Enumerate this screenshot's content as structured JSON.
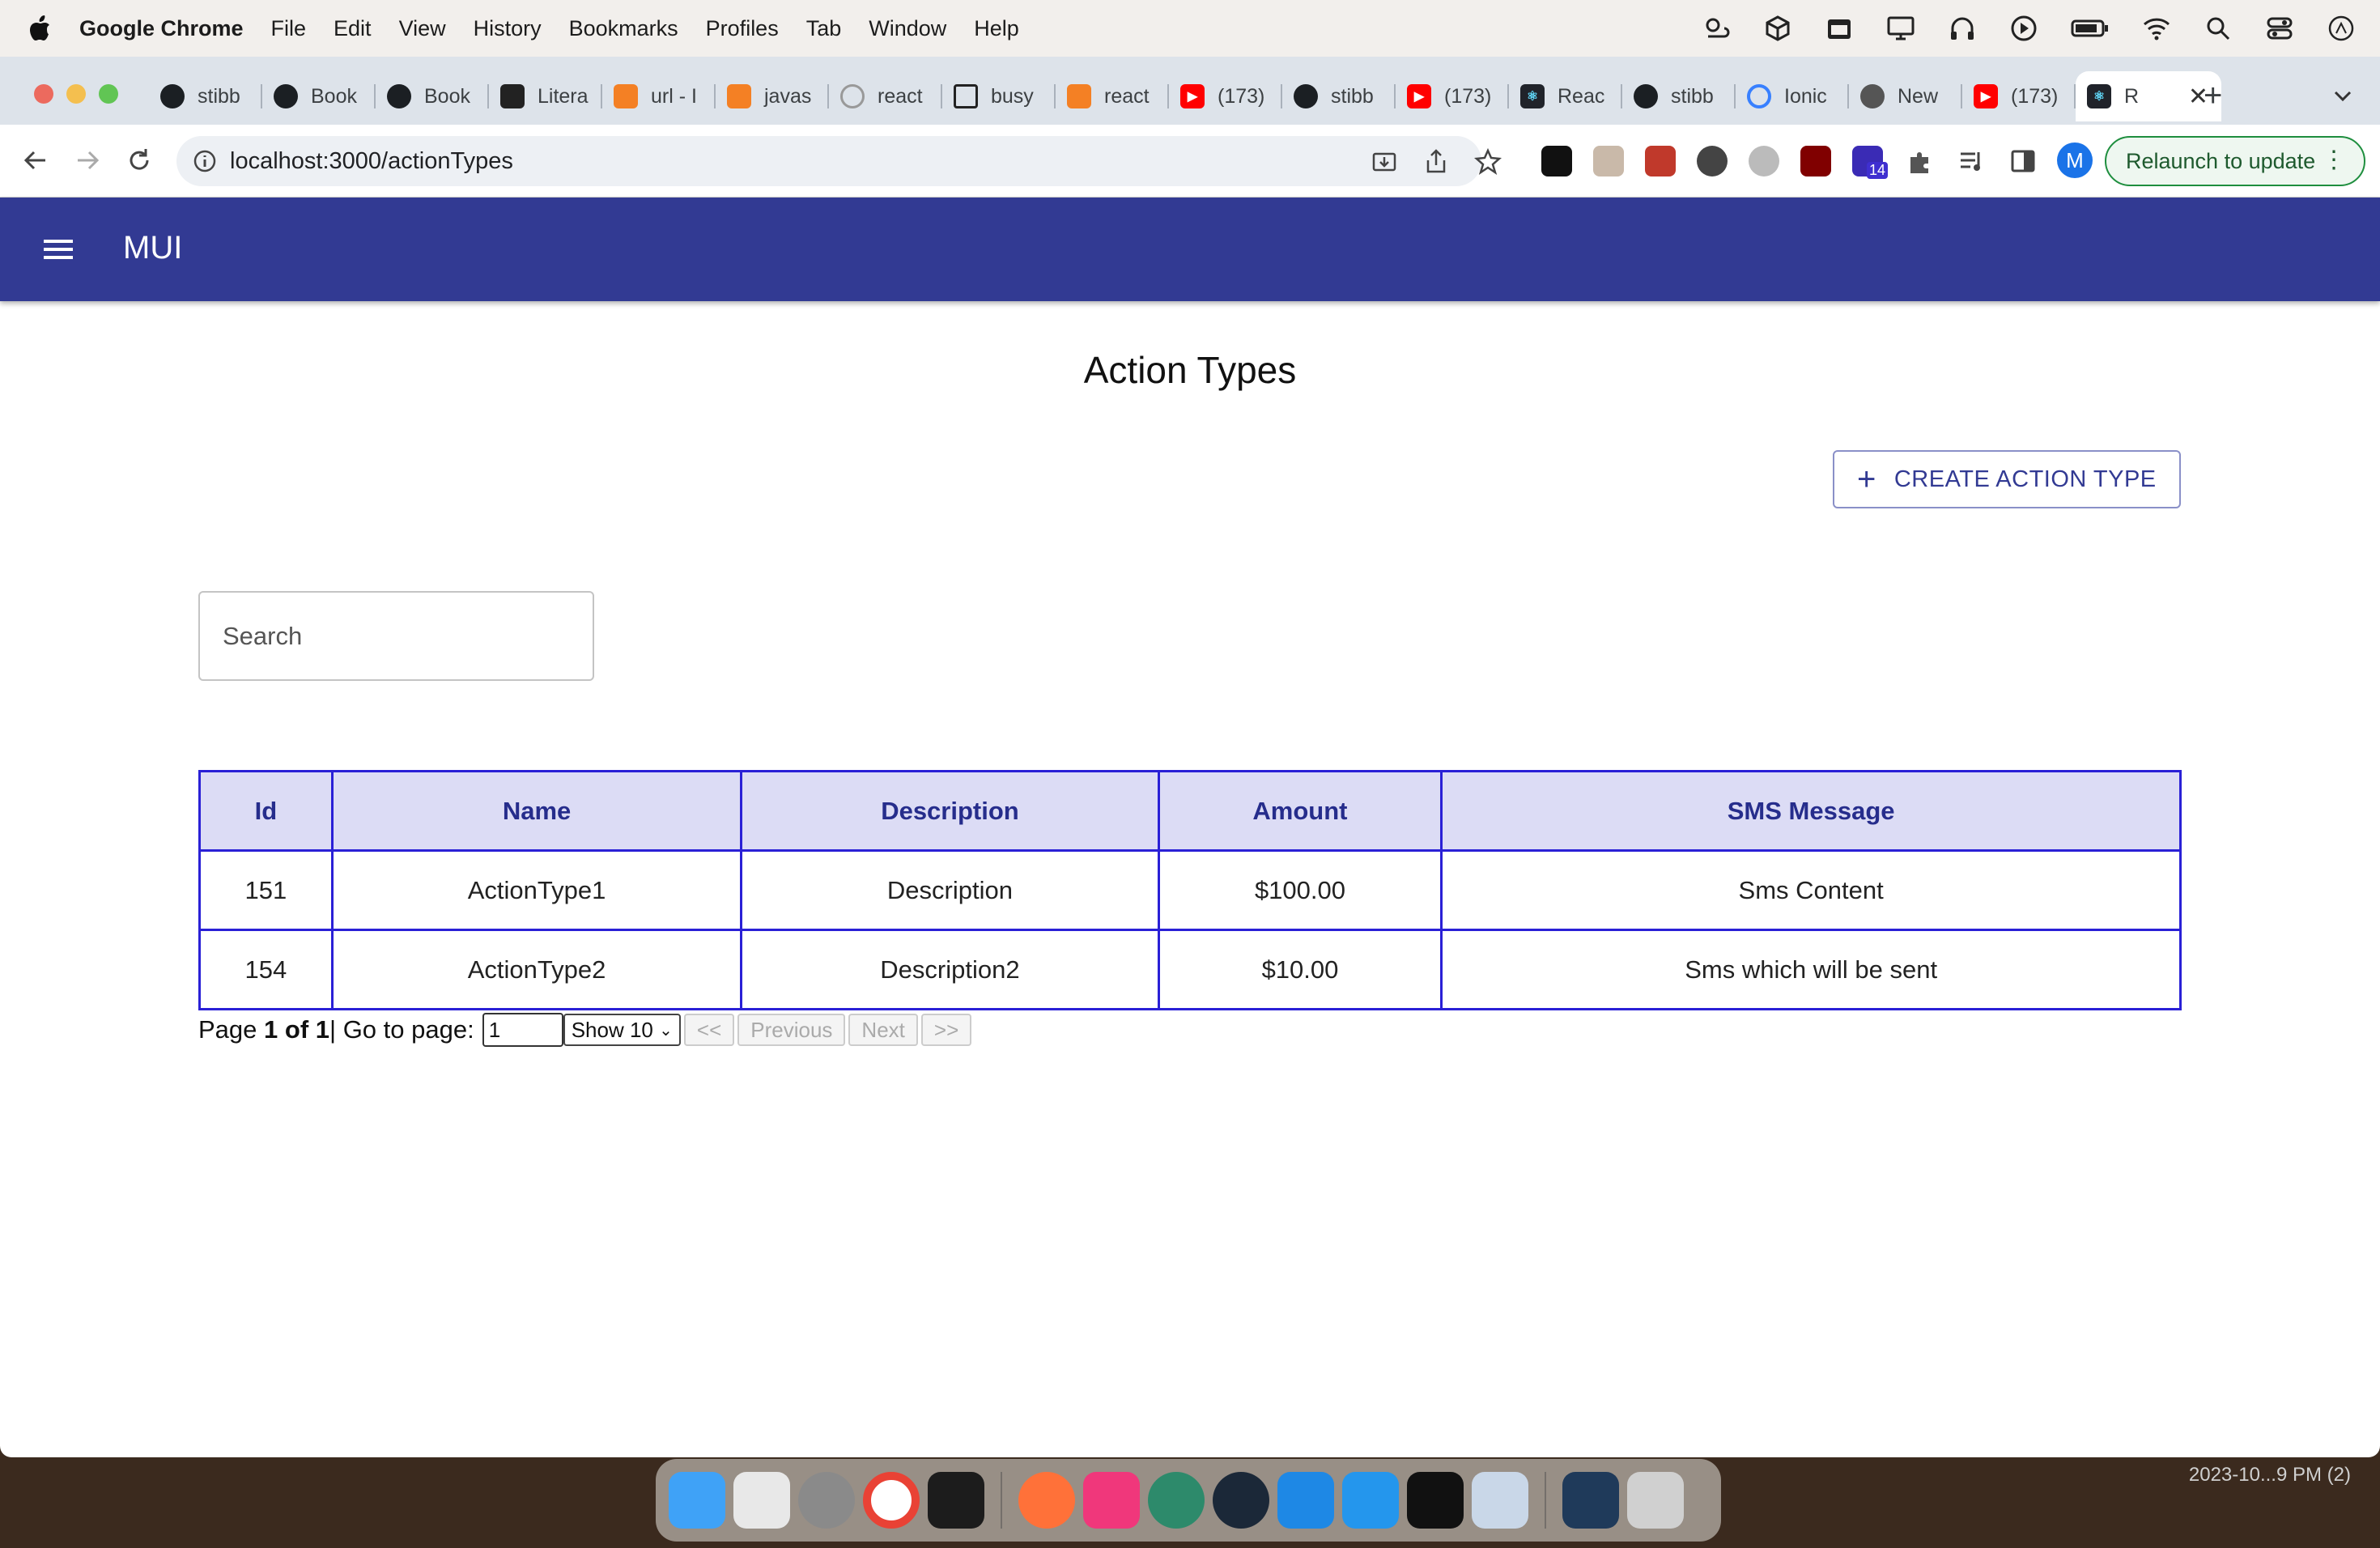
{
  "menubar": {
    "app_name": "Google Chrome",
    "items": [
      "File",
      "Edit",
      "View",
      "History",
      "Bookmarks",
      "Profiles",
      "Tab",
      "Window",
      "Help"
    ]
  },
  "browser": {
    "tabs": [
      {
        "label": "stibb",
        "icon": "github-icon"
      },
      {
        "label": "Book",
        "icon": "github-icon"
      },
      {
        "label": "Book",
        "icon": "github-icon"
      },
      {
        "label": "Litera",
        "icon": "document-icon"
      },
      {
        "label": "url - I",
        "icon": "stackoverflow-icon"
      },
      {
        "label": "javas",
        "icon": "stackoverflow-icon"
      },
      {
        "label": "react",
        "icon": "loading-icon"
      },
      {
        "label": "busy",
        "icon": "square-icon"
      },
      {
        "label": "react",
        "icon": "stackoverflow-icon"
      },
      {
        "label": "(173)",
        "icon": "youtube-icon"
      },
      {
        "label": "stibb",
        "icon": "github-icon"
      },
      {
        "label": "(173)",
        "icon": "youtube-icon"
      },
      {
        "label": "Reac",
        "icon": "react-icon"
      },
      {
        "label": "stibb",
        "icon": "github-icon"
      },
      {
        "label": "Ionic",
        "icon": "ionic-icon"
      },
      {
        "label": "New",
        "icon": "chrome-icon"
      },
      {
        "label": "(173)",
        "icon": "youtube-icon"
      }
    ],
    "active_tab": {
      "label": "R",
      "icon": "react-icon"
    },
    "url": "localhost:3000/actionTypes",
    "relaunch_label": "Relaunch to update",
    "avatar_letter": "M",
    "extension_badge": "14"
  },
  "app": {
    "brand": "MUI",
    "page_title": "Action Types",
    "create_button": "CREATE ACTION TYPE",
    "search_placeholder": "Search",
    "table": {
      "columns": [
        "Id",
        "Name",
        "Description",
        "Amount",
        "SMS Message"
      ],
      "rows": [
        [
          "151",
          "ActionType1",
          "Description",
          "$100.00",
          "Sms Content"
        ],
        [
          "154",
          "ActionType2",
          "Description2",
          "$10.00",
          "Sms which will be sent"
        ]
      ]
    },
    "pagination": {
      "page_label": "Page",
      "page_info": "1 of 1",
      "separator": "|",
      "goto_label": "Go to page:",
      "goto_value": "1",
      "page_size": "Show 10",
      "first": "<<",
      "previous": "Previous",
      "next": "Next",
      "last": ">>"
    }
  },
  "desktop": {
    "timestamp": "2023-10...9 PM (2)"
  },
  "colors": {
    "appbar": "#323a93",
    "table_border": "#2a20d6",
    "table_header_bg": "#dcdcf5"
  }
}
